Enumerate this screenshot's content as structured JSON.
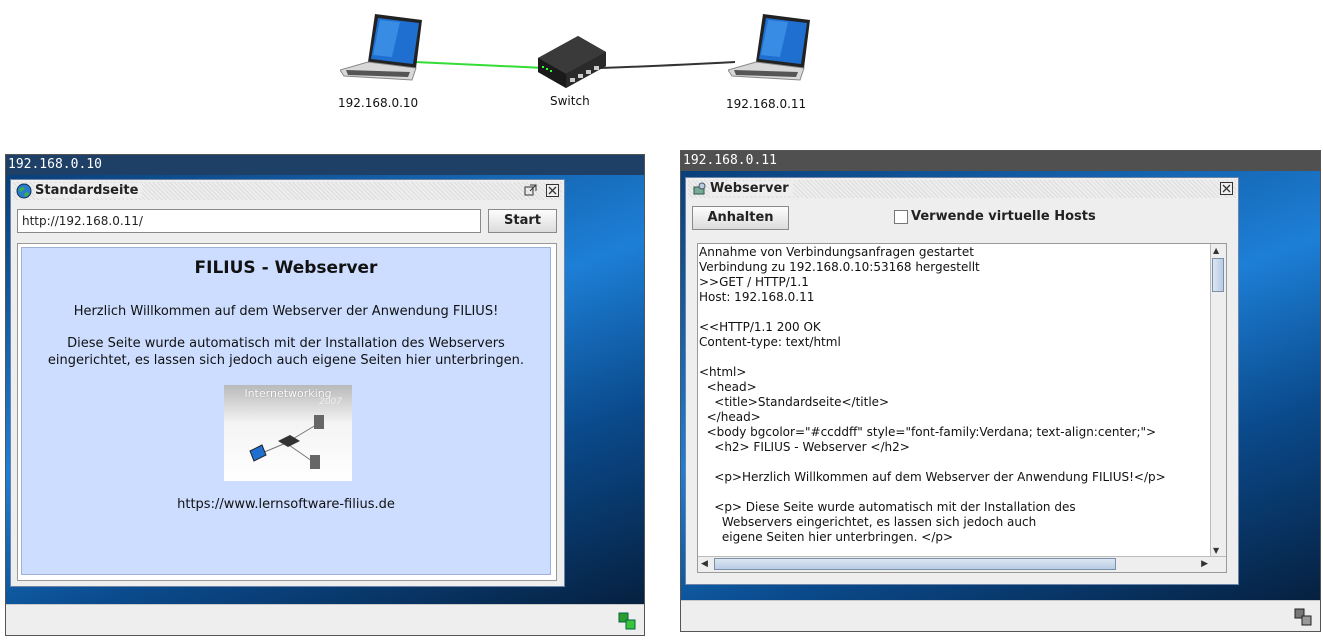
{
  "topology": {
    "nodes": [
      {
        "label": "192.168.0.10",
        "icon": "laptop-icon"
      },
      {
        "label": "Switch",
        "icon": "switch-icon"
      },
      {
        "label": "192.168.0.11",
        "icon": "laptop-icon"
      }
    ],
    "colors": {
      "active_link": "#33dd33",
      "idle_link": "#333333"
    }
  },
  "desktop_left": {
    "title": "192.168.0.10",
    "browser": {
      "window_title": "Standardseite",
      "url_value": "http://192.168.0.11/",
      "start_label": "Start",
      "page": {
        "heading": "FILIUS - Webserver",
        "welcome": "Herzlich Willkommen auf dem Webserver der Anwendung FILIUS!",
        "desc_line1": "Diese Seite wurde automatisch mit der Installation des Webservers",
        "desc_line2": "eingerichtet, es lassen sich jedoch auch eigene Seiten hier unterbringen.",
        "image_caption": "Internetworking",
        "image_year": "2007",
        "link": "https://www.lernsoftware-filius.de",
        "background": "#ccddff"
      }
    }
  },
  "desktop_right": {
    "title": "192.168.0.11",
    "webserver": {
      "window_title": "Webserver",
      "stop_label": "Anhalten",
      "vhost_label": "Verwende virtuelle Hosts",
      "vhost_checked": false,
      "log_lines": [
        "Annahme von Verbindungsanfragen gestartet",
        "Verbindung zu 192.168.0.10:53168 hergestellt",
        ">>GET / HTTP/1.1",
        "Host: 192.168.0.11",
        "",
        "<<HTTP/1.1 200 OK",
        "Content-type: text/html",
        "",
        "<html>",
        "  <head>",
        "    <title>Standardseite</title>",
        "  </head>",
        "  <body bgcolor=\"#ccddff\" style=\"font-family:Verdana; text-align:center;\">",
        "    <h2> FILIUS - Webserver </h2>",
        "",
        "    <p>Herzlich Willkommen auf dem Webserver der Anwendung FILIUS!</p>",
        "",
        "    <p> Diese Seite wurde automatisch mit der Installation des",
        "      Webservers eingerichtet, es lassen sich jedoch auch",
        "      eigene Seiten hier unterbringen. </p>"
      ]
    }
  }
}
